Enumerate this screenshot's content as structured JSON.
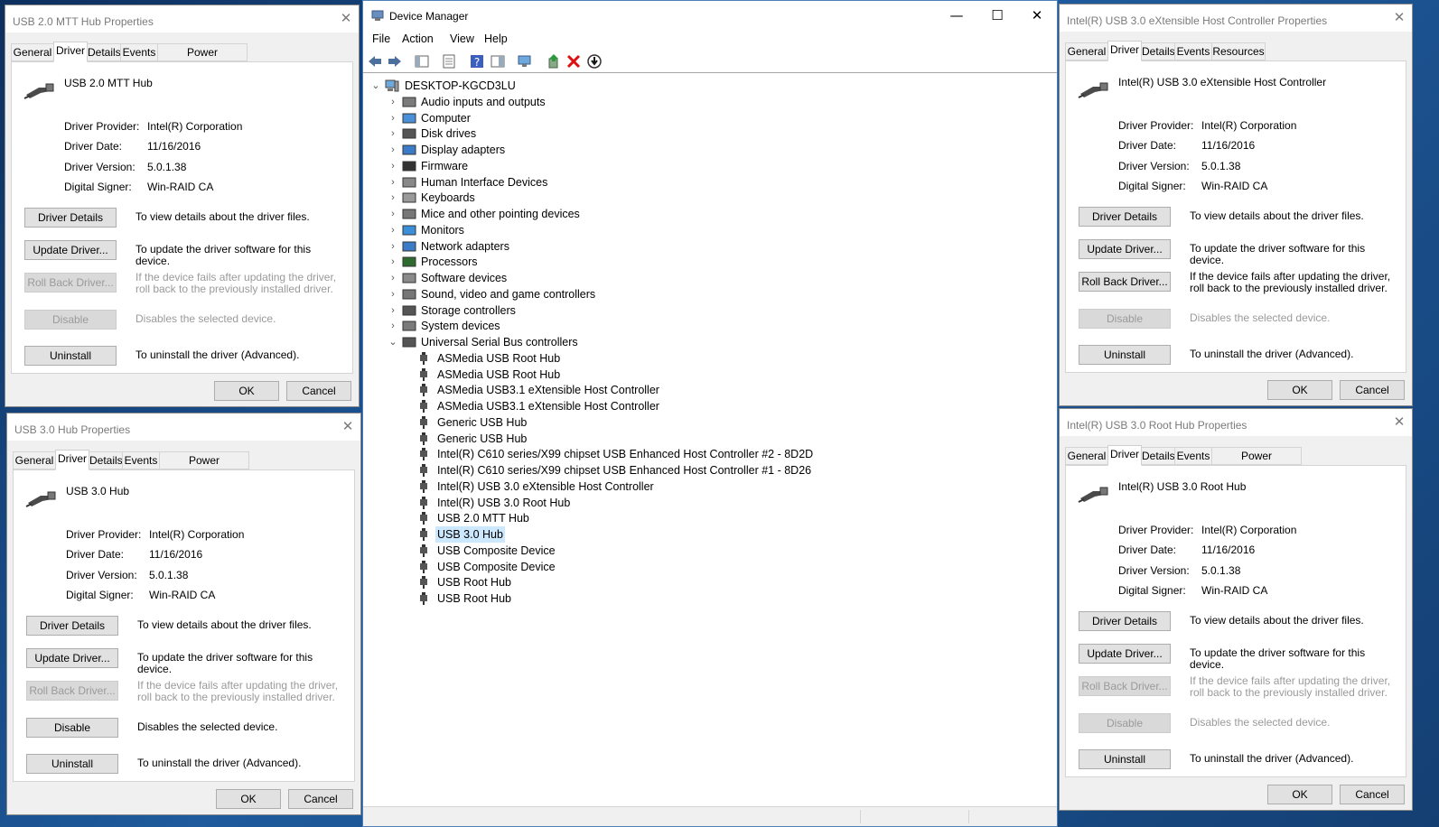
{
  "dialogs": [
    {
      "title": "USB 2.0 MTT Hub Properties",
      "tabs": [
        "General",
        "Driver",
        "Details",
        "Events",
        "Power Management"
      ],
      "device_name": "USB 2.0 MTT Hub",
      "labels": {
        "provider": "Driver Provider:",
        "date": "Driver Date:",
        "version": "Driver Version:",
        "signer": "Digital Signer:"
      },
      "values": {
        "provider": "Intel(R) Corporation",
        "date": "11/16/2016",
        "version": "5.0.1.38",
        "signer": "Win-RAID CA"
      },
      "buttons": {
        "details": "Driver Details",
        "update": "Update Driver...",
        "rollback": "Roll Back Driver...",
        "disable": "Disable",
        "uninstall": "Uninstall"
      },
      "descs": {
        "details": "To view details about the driver files.",
        "update": "To update the driver software for this device.",
        "rollback": "If the device fails after updating the driver, roll back to the previously installed driver.",
        "disable": "Disables the selected device.",
        "uninstall": "To uninstall the driver (Advanced)."
      },
      "ok": "OK",
      "cancel": "Cancel"
    },
    {
      "title": "USB 3.0 Hub Properties",
      "tabs": [
        "General",
        "Driver",
        "Details",
        "Events",
        "Power Management"
      ],
      "device_name": "USB 3.0 Hub",
      "labels": {
        "provider": "Driver Provider:",
        "date": "Driver Date:",
        "version": "Driver Version:",
        "signer": "Digital Signer:"
      },
      "values": {
        "provider": "Intel(R) Corporation",
        "date": "11/16/2016",
        "version": "5.0.1.38",
        "signer": "Win-RAID CA"
      },
      "buttons": {
        "details": "Driver Details",
        "update": "Update Driver...",
        "rollback": "Roll Back Driver...",
        "disable": "Disable",
        "uninstall": "Uninstall"
      },
      "descs": {
        "details": "To view details about the driver files.",
        "update": "To update the driver software for this device.",
        "rollback": "If the device fails after updating the driver, roll back to the previously installed driver.",
        "disable": "Disables the selected device.",
        "uninstall": "To uninstall the driver (Advanced)."
      },
      "ok": "OK",
      "cancel": "Cancel"
    },
    {
      "title": "Intel(R) USB 3.0 eXtensible Host Controller Properties",
      "tabs": [
        "General",
        "Driver",
        "Details",
        "Events",
        "Resources"
      ],
      "device_name": "Intel(R) USB 3.0 eXtensible Host Controller",
      "labels": {
        "provider": "Driver Provider:",
        "date": "Driver Date:",
        "version": "Driver Version:",
        "signer": "Digital Signer:"
      },
      "values": {
        "provider": "Intel(R) Corporation",
        "date": "11/16/2016",
        "version": "5.0.1.38",
        "signer": "Win-RAID CA"
      },
      "buttons": {
        "details": "Driver Details",
        "update": "Update Driver...",
        "rollback": "Roll Back Driver...",
        "disable": "Disable",
        "uninstall": "Uninstall"
      },
      "descs": {
        "details": "To view details about the driver files.",
        "update": "To update the driver software for this device.",
        "rollback": "If the device fails after updating the driver, roll back to the previously installed driver.",
        "disable": "Disables the selected device.",
        "uninstall": "To uninstall the driver (Advanced)."
      },
      "ok": "OK",
      "cancel": "Cancel"
    },
    {
      "title": "Intel(R) USB 3.0 Root Hub Properties",
      "tabs": [
        "General",
        "Driver",
        "Details",
        "Events",
        "Power Management"
      ],
      "device_name": "Intel(R) USB 3.0 Root Hub",
      "labels": {
        "provider": "Driver Provider:",
        "date": "Driver Date:",
        "version": "Driver Version:",
        "signer": "Digital Signer:"
      },
      "values": {
        "provider": "Intel(R) Corporation",
        "date": "11/16/2016",
        "version": "5.0.1.38",
        "signer": "Win-RAID CA"
      },
      "buttons": {
        "details": "Driver Details",
        "update": "Update Driver...",
        "rollback": "Roll Back Driver...",
        "disable": "Disable",
        "uninstall": "Uninstall"
      },
      "descs": {
        "details": "To view details about the driver files.",
        "update": "To update the driver software for this device.",
        "rollback": "If the device fails after updating the driver, roll back to the previously installed driver.",
        "disable": "Disables the selected device.",
        "uninstall": "To uninstall the driver (Advanced)."
      },
      "ok": "OK",
      "cancel": "Cancel"
    }
  ],
  "device_manager": {
    "title": "Device Manager",
    "menu": [
      "File",
      "Action",
      "View",
      "Help"
    ],
    "root": "DESKTOP-KGCD3LU",
    "categories": [
      "Audio inputs and outputs",
      "Computer",
      "Disk drives",
      "Display adapters",
      "Firmware",
      "Human Interface Devices",
      "Keyboards",
      "Mice and other pointing devices",
      "Monitors",
      "Network adapters",
      "Processors",
      "Software devices",
      "Sound, video and game controllers",
      "Storage controllers",
      "System devices",
      "Universal Serial Bus controllers"
    ],
    "usb_devices": [
      "ASMedia USB Root Hub",
      "ASMedia USB Root Hub",
      "ASMedia USB3.1 eXtensible Host Controller",
      "ASMedia USB3.1 eXtensible Host Controller",
      "Generic USB Hub",
      "Generic USB Hub",
      "Intel(R) C610 series/X99 chipset USB Enhanced Host Controller #2 - 8D2D",
      "Intel(R) C610 series/X99 chipset USB Enhanced Host Controller #1 - 8D26",
      "Intel(R) USB 3.0 eXtensible Host Controller",
      "Intel(R) USB 3.0 Root Hub",
      "USB 2.0 MTT Hub",
      "USB 3.0 Hub",
      "USB Composite Device",
      "USB Composite Device",
      "USB Root Hub",
      "USB Root Hub"
    ],
    "selected_device": "USB 3.0 Hub"
  },
  "colors": {
    "selection": "#cce8ff",
    "window_border": "#4f80b5",
    "dialog_bg": "#f0f0f0"
  }
}
